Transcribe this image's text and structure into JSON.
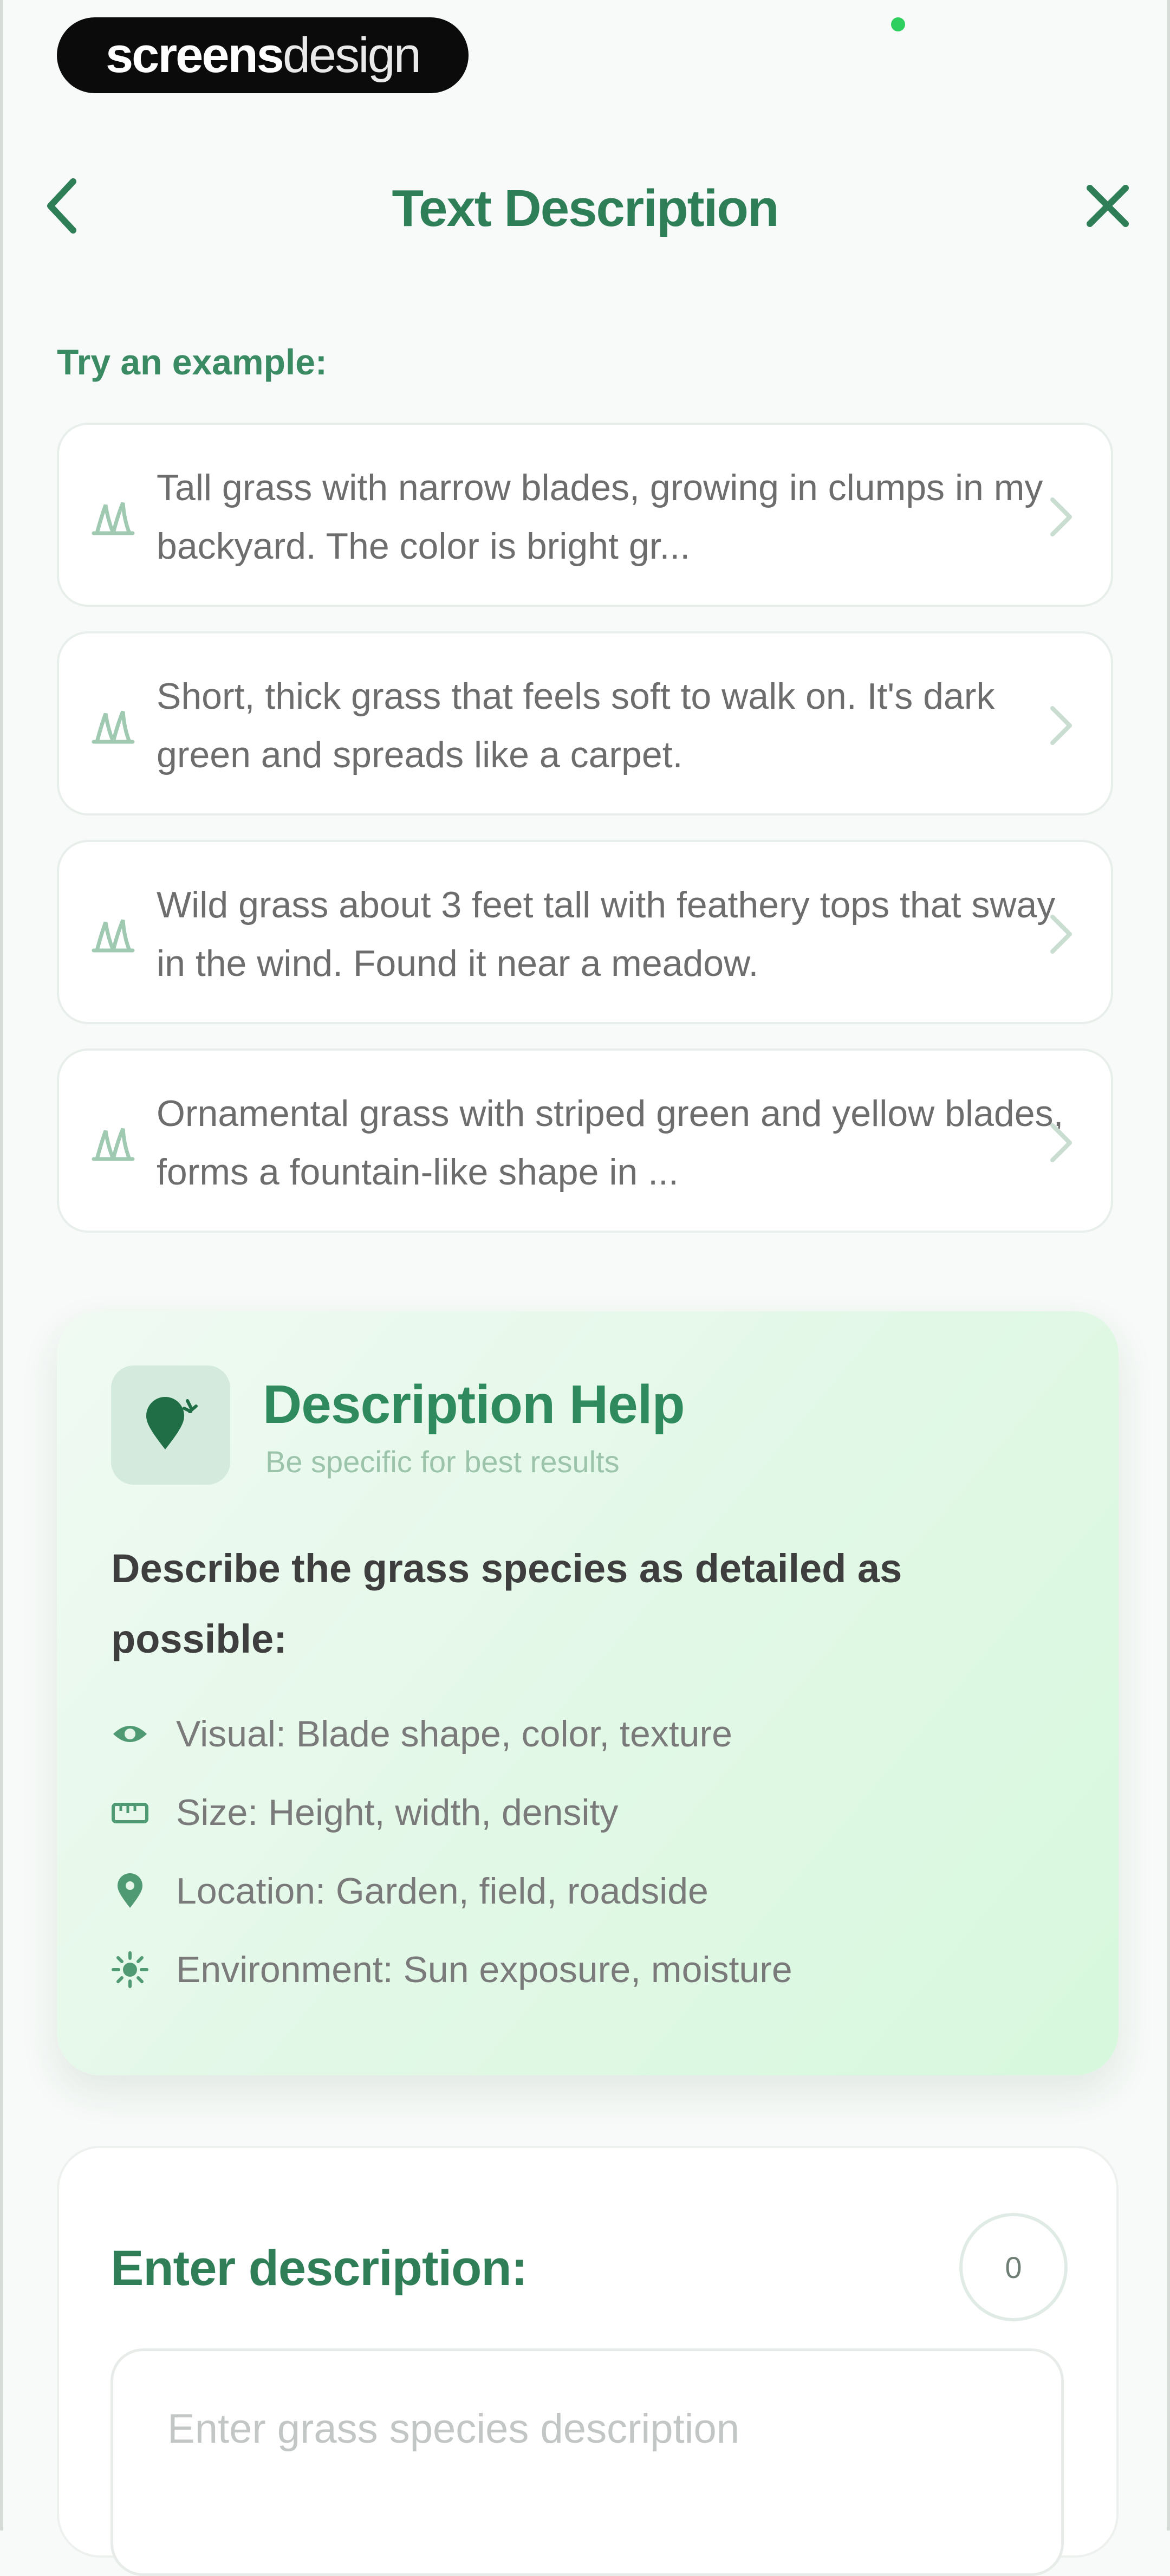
{
  "brand": {
    "badge_bold": "screens",
    "badge_light": "design"
  },
  "header": {
    "title": "Text Description"
  },
  "examples": {
    "label": "Try an example:",
    "items": [
      {
        "text": "Tall grass with narrow blades, growing in clumps in my backyard. The color is bright gr..."
      },
      {
        "text": "Short, thick grass that feels soft to walk on. It's dark green and spreads like a carpet."
      },
      {
        "text": "Wild grass about 3 feet tall with feathery tops that sway in the wind. Found it near a meadow."
      },
      {
        "text": "Ornamental grass with striped green and yellow blades, forms a fountain-like shape in ..."
      }
    ]
  },
  "help": {
    "title": "Description Help",
    "subtitle": "Be specific for best results",
    "lead": "Describe the grass species as detailed as possible:",
    "items": [
      {
        "icon": "eye-icon",
        "label": "Visual: Blade shape, color, texture"
      },
      {
        "icon": "ruler-icon",
        "label": "Size: Height, width, density"
      },
      {
        "icon": "location-pin-icon",
        "label": "Location: Garden, field, roadside"
      },
      {
        "icon": "sun-icon",
        "label": "Environment: Sun exposure, moisture"
      }
    ]
  },
  "input": {
    "title": "Enter description:",
    "counter": "0",
    "placeholder": "Enter grass species description"
  },
  "colors": {
    "accent": "#2f8a5d",
    "card_bg": "#e1f8e6",
    "muted_text": "#6d6d6d"
  }
}
